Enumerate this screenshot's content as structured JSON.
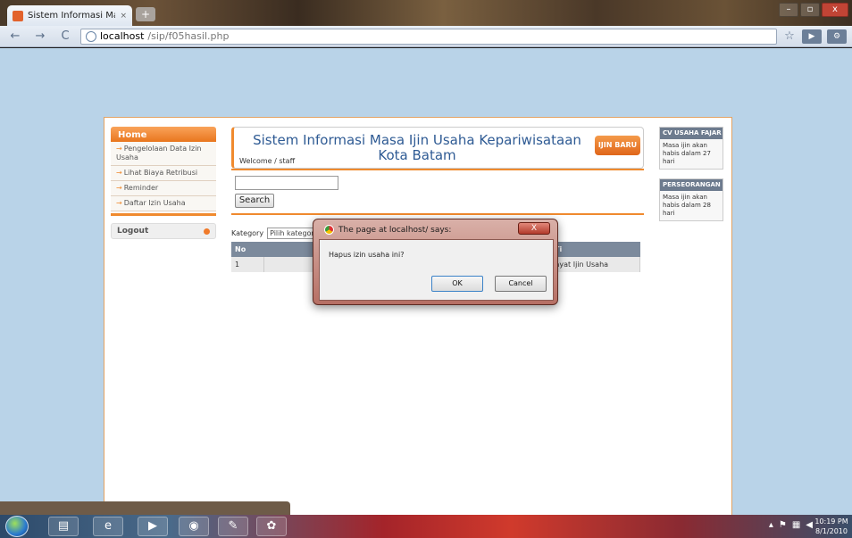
{
  "browser": {
    "tab_title": "Sistem Informasi Masa Iji...",
    "tab_close": "×",
    "new_tab": "+",
    "url_host": "localhost",
    "url_path": "/sip/f05hasil.php",
    "back": "←",
    "forward": "→",
    "reload": "C",
    "bookmark": "☆",
    "window_min": "–",
    "window_max": "▫",
    "window_close": "x"
  },
  "nav": {
    "home": "Home",
    "items": [
      "Pengelolaan Data Izin Usaha",
      "Lihat Biaya Retribusi",
      "Reminder",
      "Daftar Izin Usaha"
    ],
    "logout": "Logout"
  },
  "header": {
    "title": "Sistem Informasi Masa Ijin Usaha Kepariwisataan Kota Batam",
    "welcome": "Welcome / staff",
    "new_button": "IJIN BARU"
  },
  "search": {
    "button": "Search",
    "value": ""
  },
  "filter": {
    "label": "Kategory",
    "selected": "Pilih kategori"
  },
  "table": {
    "headers": [
      "No",
      "",
      "Ti"
    ],
    "rows": [
      [
        "1",
        "P",
        "ayat Ijin Usaha"
      ]
    ]
  },
  "sidebar": {
    "boxes": [
      {
        "title": "CV USAHA FAJAR",
        "text": "Masa ijin akan habis dalam 27 hari"
      },
      {
        "title": "PERSEORANGAN",
        "text": "Masa ijin akan habis dalam 28 hari"
      }
    ]
  },
  "dialog": {
    "title": "The page at localhost/ says:",
    "message": "Hapus izin usaha ini?",
    "ok": "OK",
    "cancel": "Cancel",
    "close": "X"
  },
  "taskbar": {
    "time": "10:19 PM",
    "date": "8/1/2010"
  },
  "colors": {
    "accent": "#f08a2e",
    "title_blue": "#2f5b94",
    "page_bg": "#b9d3e8"
  }
}
